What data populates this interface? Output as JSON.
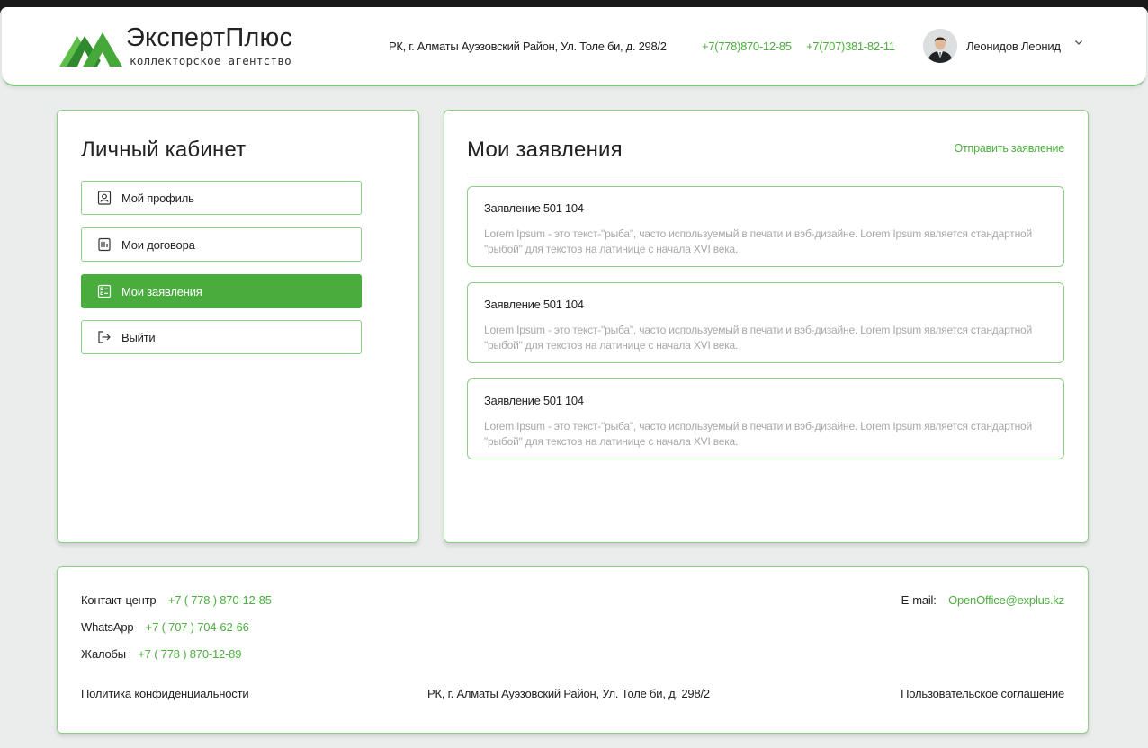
{
  "header": {
    "logo_name": "ЭкспертПлюс",
    "logo_subtitle": "коллекторское агентство",
    "address": "РК, г. Алматы Ауэзовский Район, Ул. Толе би, д. 298/2",
    "phone1": "+7(778)870-12-85",
    "phone2": "+7(707)381-82-11",
    "user_name": "Леонидов Леонид"
  },
  "sidebar": {
    "title": "Личный кабинет",
    "items": [
      {
        "label": "Мой профиль",
        "icon": "profile-icon",
        "active": false
      },
      {
        "label": "Мои договора",
        "icon": "contract-icon",
        "active": false
      },
      {
        "label": "Мои заявления",
        "icon": "application-list-icon",
        "active": true
      },
      {
        "label": "Выйти",
        "icon": "logout-icon",
        "active": false
      }
    ]
  },
  "main": {
    "title": "Мои заявления",
    "send_label": "Отправить заявление",
    "applications": [
      {
        "title": "Заявление 501 104",
        "text": "Lorem Ipsum - это текст-\"рыба\", часто используемый в печати и вэб-дизайне. Lorem Ipsum является стандартной \"рыбой\" для текстов на латинице с начала XVI века."
      },
      {
        "title": "Заявление 501 104",
        "text": "Lorem Ipsum - это текст-\"рыба\", часто используемый в печати и вэб-дизайне. Lorem Ipsum является стандартной \"рыбой\" для текстов на латинице с начала XVI века."
      },
      {
        "title": "Заявление 501 104",
        "text": "Lorem Ipsum - это текст-\"рыба\", часто используемый в печати и вэб-дизайне. Lorem Ipsum является стандартной \"рыбой\" для текстов на латинице с начала XVI века."
      }
    ]
  },
  "footer": {
    "contact_label": "Контакт-центр",
    "contact_phone": "+7 ( 778 ) 870-12-85",
    "whatsapp_label": "WhatsApp",
    "whatsapp_phone": "+7 ( 707 ) 704-62-66",
    "complaints_label": "Жалобы",
    "complaints_phone": "+7 ( 778 ) 870-12-89",
    "email_label": "E-mail:",
    "email": "OpenOffice@explus.kz",
    "privacy": "Политика конфиденциальности",
    "address": "РК, г. Алматы Ауэзовский Район, Ул. Толе би, д. 298/2",
    "agreement": "Пользовательское соглашение"
  },
  "colors": {
    "accent": "#48ad3c",
    "accent_text": "#4caf3f",
    "border": "#8ccf86",
    "background": "#ebecec"
  }
}
